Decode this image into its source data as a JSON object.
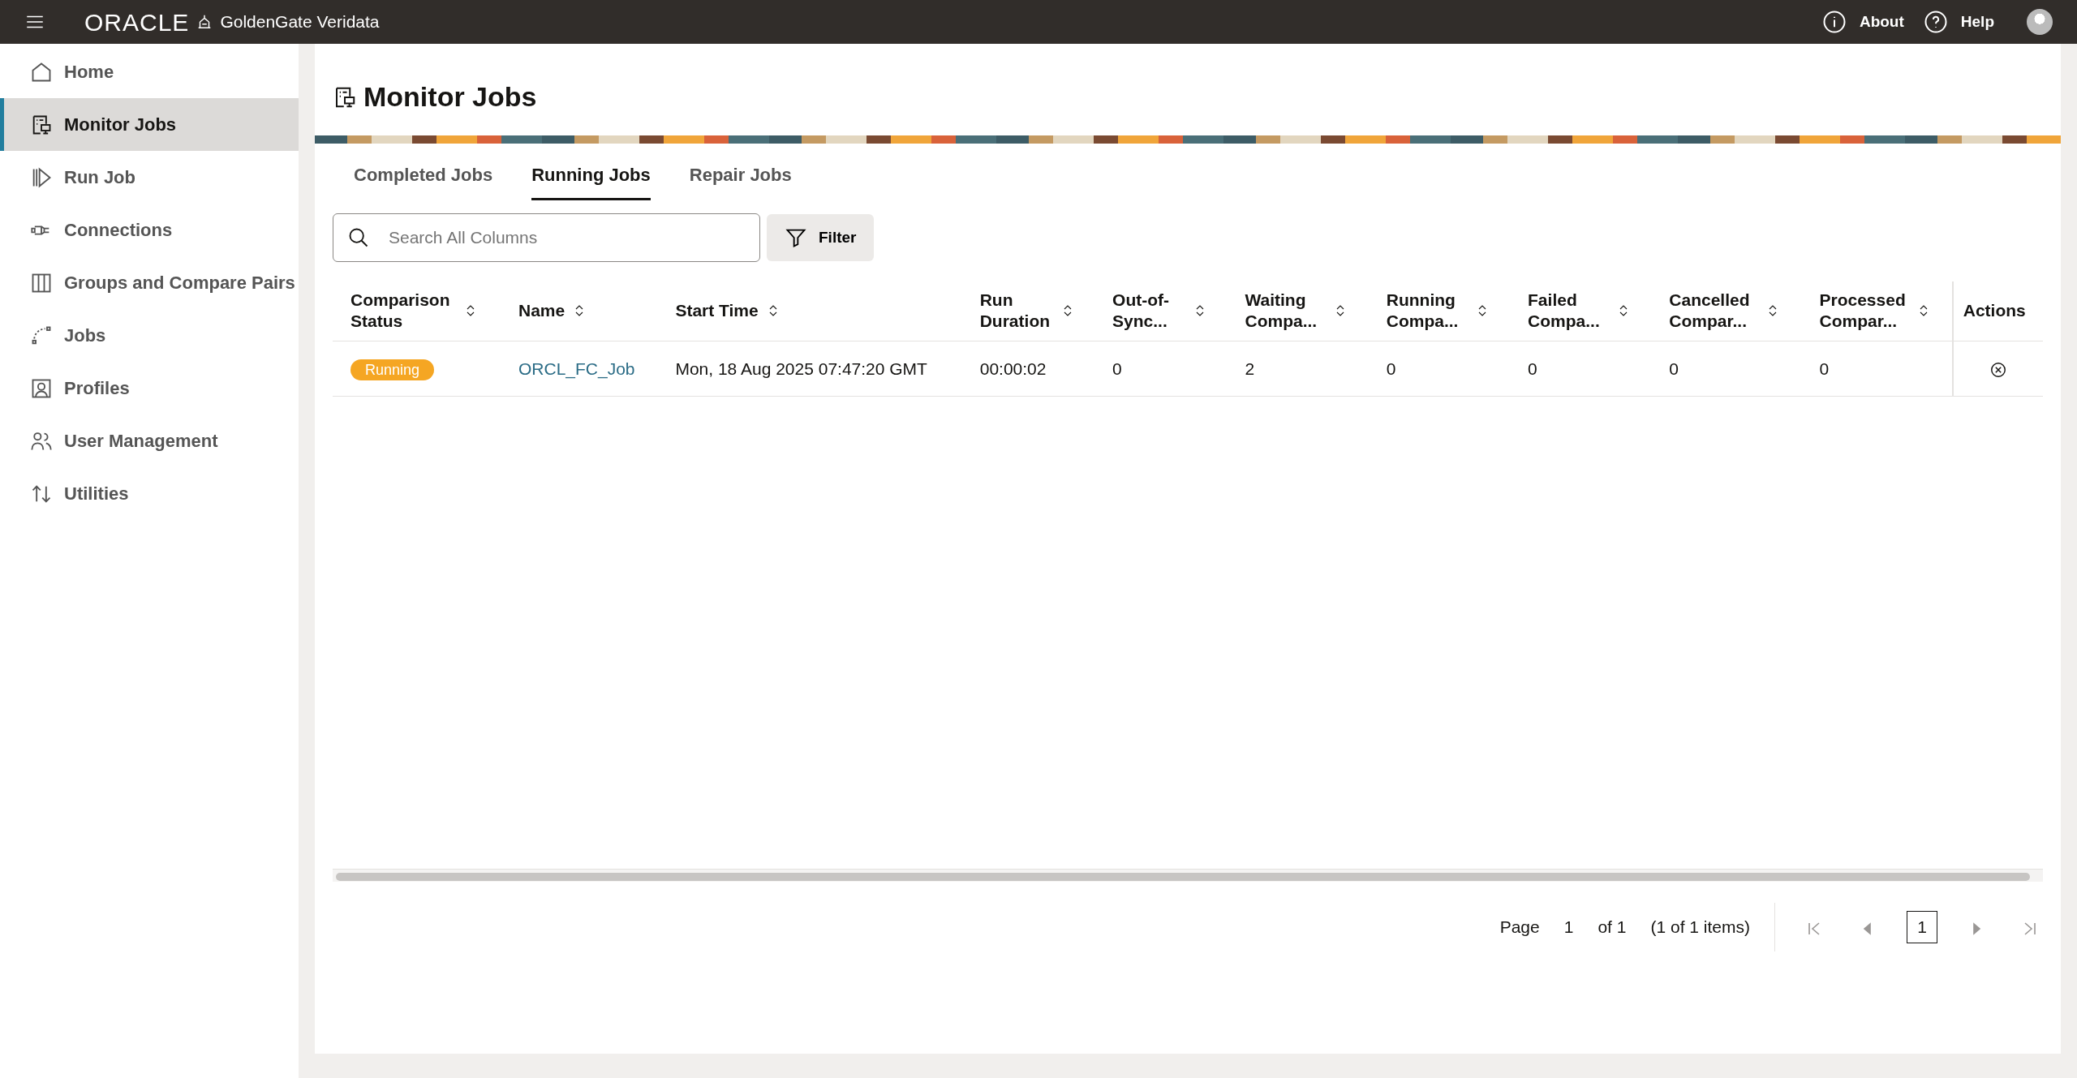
{
  "topbar": {
    "brand": "ORACLE",
    "product": "GoldenGate Veridata",
    "links": [
      "About",
      "Help"
    ]
  },
  "sidebar": {
    "items": [
      {
        "label": "Home",
        "selected": false
      },
      {
        "label": "Monitor Jobs",
        "selected": true
      },
      {
        "label": "Run Job",
        "selected": false
      },
      {
        "label": "Connections",
        "selected": false
      },
      {
        "label": "Groups and Compare Pairs",
        "selected": false
      },
      {
        "label": "Jobs",
        "selected": false
      },
      {
        "label": "Profiles",
        "selected": false
      },
      {
        "label": "User Management",
        "selected": false
      },
      {
        "label": "Utilities",
        "selected": false
      }
    ]
  },
  "page": {
    "title": "Monitor Jobs"
  },
  "tabs": [
    {
      "label": "Completed Jobs",
      "selected": false
    },
    {
      "label": "Running Jobs",
      "selected": true
    },
    {
      "label": "Repair Jobs",
      "selected": false
    }
  ],
  "search": {
    "placeholder": "Search All Columns"
  },
  "filter_button": "Filter",
  "table": {
    "columns": [
      {
        "label": "Comparison Status",
        "sortable": true
      },
      {
        "label": "Name",
        "sortable": true
      },
      {
        "label": "Start Time",
        "sortable": true
      },
      {
        "label": "Run Duration",
        "sortable": true
      },
      {
        "label": "Out-of-Sync...",
        "sortable": true
      },
      {
        "label": "Waiting Compa...",
        "sortable": true
      },
      {
        "label": "Running Compa...",
        "sortable": true
      },
      {
        "label": "Failed Compa...",
        "sortable": true
      },
      {
        "label": "Cancelled Compar...",
        "sortable": true
      },
      {
        "label": "Processed Compar...",
        "sortable": true
      },
      {
        "label": "Actions",
        "sortable": false
      }
    ],
    "rows": [
      {
        "cells": [
          {
            "kind": "badge",
            "text": "Running",
            "color": "#f5a623"
          },
          {
            "kind": "link",
            "text": "ORCL_FC_Job"
          },
          {
            "kind": "text",
            "text": "Mon, 18 Aug 2025 07:47:20 GMT"
          },
          {
            "kind": "text",
            "text": "00:00:02"
          },
          {
            "kind": "text",
            "text": "0"
          },
          {
            "kind": "text",
            "text": "2"
          },
          {
            "kind": "text",
            "text": "0"
          },
          {
            "kind": "text",
            "text": "0"
          },
          {
            "kind": "text",
            "text": "0"
          },
          {
            "kind": "text",
            "text": "0"
          },
          {
            "kind": "action"
          }
        ]
      }
    ]
  },
  "pagination": {
    "label": "Page",
    "current": "1",
    "of": "of 1",
    "summary": "(1 of 1 items)",
    "buttons": [
      {
        "kind": "first",
        "disabled": true
      },
      {
        "kind": "prev",
        "disabled": true
      },
      {
        "kind": "page",
        "text": "1",
        "selected": true
      },
      {
        "kind": "next",
        "disabled": true
      },
      {
        "kind": "last",
        "disabled": true
      }
    ]
  }
}
